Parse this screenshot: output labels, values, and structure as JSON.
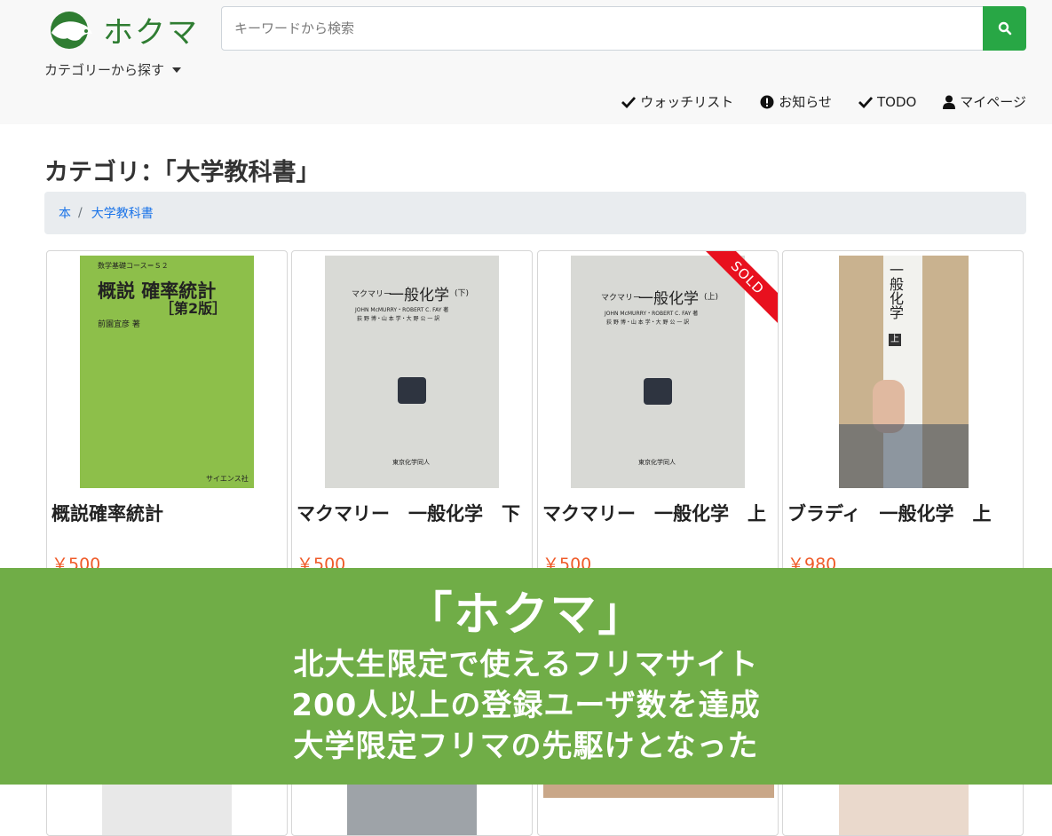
{
  "header": {
    "logo_text": "ホクマ",
    "search_placeholder": "キーワードから検索",
    "category_dropdown": "カテゴリーから探す",
    "nav": [
      {
        "label": "ウォッチリスト",
        "icon": "check-icon"
      },
      {
        "label": "お知らせ",
        "icon": "exclamation-circle-icon"
      },
      {
        "label": "TODO",
        "icon": "check-icon"
      },
      {
        "label": "マイページ",
        "icon": "user-icon"
      }
    ]
  },
  "page": {
    "title": "カテゴリ：「大学教科書」",
    "breadcrumb": [
      "本",
      "大学教科書"
    ],
    "breadcrumb_sep": "/"
  },
  "products": [
    {
      "title": "概説確率統計",
      "price": "￥500",
      "sold": false,
      "cover": {
        "series": "数学基礎コース＝Ｓ２",
        "title": "概説 確率統計",
        "edition": "［第2版］",
        "author": "前園宜彦 著",
        "publisher": "サイエンス社"
      }
    },
    {
      "title": "マクマリー　一般化学　下",
      "price": "￥500",
      "sold": false,
      "cover": {
        "prefix": "マクマリー",
        "title": "一般化学",
        "vol": "(下)",
        "authors": "JOHN McMURRY・ROBERT C. FAY 著",
        "translators": "荻 野 博・山 本 学・大 野 公 一 訳",
        "publisher": "東京化学同人"
      }
    },
    {
      "title": "マクマリー　一般化学　上",
      "price": "￥500",
      "sold": true,
      "cover": {
        "prefix": "マクマリー",
        "title": "一般化学",
        "vol": "(上)",
        "authors": "JOHN McMURRY・ROBERT C. FAY 著",
        "translators": "荻 野 博・山 本 学・大 野 公 一 訳",
        "publisher": "東京化学同人"
      }
    },
    {
      "title": "ブラディ　一般化学　上",
      "price": "￥980",
      "sold": false,
      "cover": {
        "spine_title": "一般化学",
        "vol": "上"
      }
    }
  ],
  "sold_label": "SOLD",
  "banner": {
    "headline": "「ホクマ」",
    "lines": [
      "北大生限定で使えるフリマサイト",
      "200人以上の登録ユーザ数を達成",
      "大学限定フリマの先駆けとなった"
    ]
  },
  "colors": {
    "brand_green": "#2f7d32",
    "search_button": "#28a745",
    "price": "#ef5a28",
    "banner": "#70ad47",
    "sold_ribbon": "#e8101e"
  }
}
